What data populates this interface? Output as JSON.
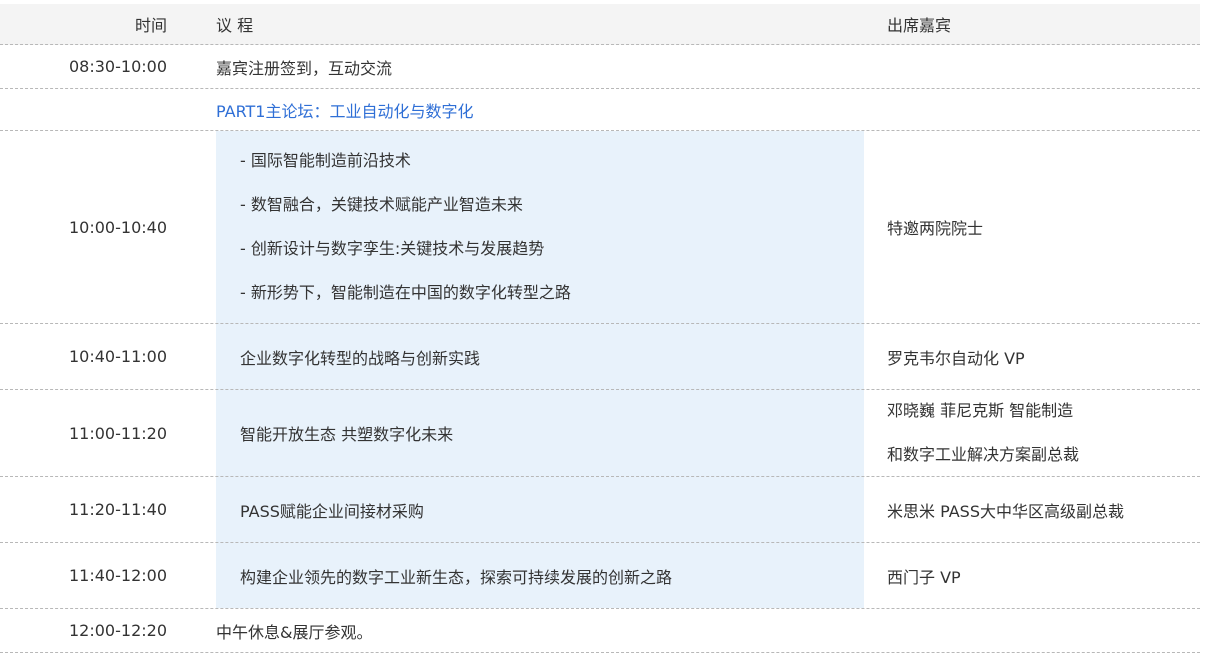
{
  "header": {
    "time": "时间",
    "agenda": "议 程",
    "speaker": "出席嘉宾"
  },
  "rows": [
    {
      "time": "08:30-10:00",
      "agenda": "嘉宾注册签到，互动交流",
      "speaker": ""
    },
    {
      "time": "",
      "agenda": "PART1主论坛：工业自动化与数字化",
      "speaker": ""
    },
    {
      "time": "10:00-10:40",
      "agenda_items": [
        "- 国际智能制造前沿技术",
        "- 数智融合，关键技术赋能产业智造未来",
        "- 创新设计与数字孪生:关键技术与发展趋势",
        "- 新形势下，智能制造在中国的数字化转型之路"
      ],
      "speaker": "特邀两院院士"
    },
    {
      "time": "10:40-11:00",
      "agenda": "企业数字化转型的战略与创新实践",
      "speaker": "罗克韦尔自动化 VP"
    },
    {
      "time": "11:00-11:20",
      "agenda": "智能开放生态 共塑数字化未来",
      "speaker_lines": [
        "邓晓巍 菲尼克斯 智能制造",
        "和数字工业解决方案副总裁"
      ]
    },
    {
      "time": "11:20-11:40",
      "agenda": "PASS赋能企业间接材采购",
      "speaker": "米思米 PASS大中华区高级副总裁"
    },
    {
      "time": "11:40-12:00",
      "agenda": "构建企业领先的数字工业新生态，探索可持续发展的创新之路",
      "speaker": "西门子 VP"
    },
    {
      "time": "12:00-12:20",
      "agenda": "中午休息&展厅参观。",
      "speaker": ""
    }
  ],
  "colors": {
    "accent": "#2f6fd6",
    "highlight": "#e8f2fb",
    "header_bg": "#f4f4f4"
  }
}
